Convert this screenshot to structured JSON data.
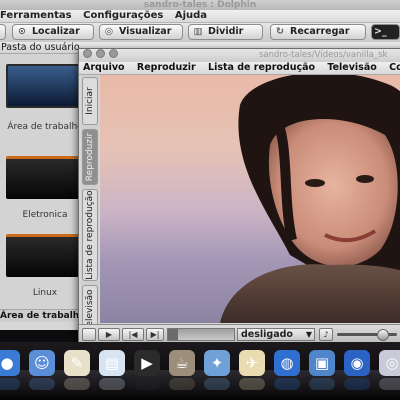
{
  "dolphin": {
    "window_title": "sandro-tales : Dolphin",
    "menus": [
      "Ferramentas",
      "Configurações",
      "Ajuda"
    ],
    "toolbar": {
      "find": "Localizar",
      "preview": "Visualizar",
      "split": "Dividir",
      "reload": "Recarregar",
      "terminal": ">_"
    },
    "places_header": "Pasta do usuário",
    "places": [
      {
        "label": "Área de trabalho",
        "icon": "desktop-icon"
      },
      {
        "label": "Eletronica",
        "icon": "folder-icon"
      },
      {
        "label": "Linux",
        "icon": "folder-icon"
      }
    ],
    "status": "Área de trabalho"
  },
  "player": {
    "window_title": "sandro-tales/Vídeos/vanilla_sk",
    "menus": [
      "Arquivo",
      "Reproduzir",
      "Lista de reprodução",
      "Televisão",
      "Co"
    ],
    "side_tabs": [
      {
        "label": "Iniciar",
        "active": false
      },
      {
        "label": "Reproduzir",
        "active": true
      },
      {
        "label": "Lista de reprodução",
        "active": false
      },
      {
        "label": "Televisão",
        "active": false
      }
    ],
    "controls": {
      "mode": "desligado",
      "seek_fraction": 0.15,
      "volume_fraction": 0.75
    }
  },
  "dock": {
    "icons": [
      "blue-orb-icon",
      "finder-icon",
      "notes-icon",
      "document-icon",
      "media-play-icon",
      "teacup-icon",
      "wand-icon",
      "paper-plane-icon",
      "globe-icon",
      "picture-icon",
      "sphere-icon",
      "disc-icon"
    ],
    "colors": [
      "#3a7bd5",
      "#5a8fd8",
      "#e8e0c8",
      "#d9e4f2",
      "#2b2b2b",
      "#9b8f7a",
      "#6fa0d8",
      "#e9dcb0",
      "#2f6fd0",
      "#4f86c9",
      "#2a63c4",
      "#c9c9d9"
    ]
  }
}
